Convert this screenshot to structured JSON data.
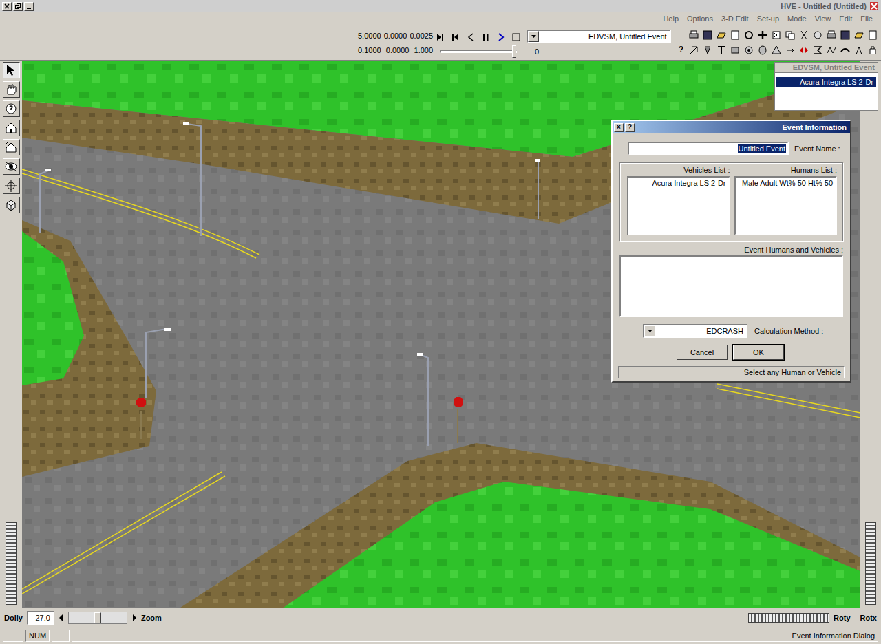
{
  "window": {
    "title": "HVE - Untitled (Untitled)"
  },
  "menu": [
    "File",
    "Edit",
    "View",
    "Mode",
    "Set-up",
    "3-D Edit",
    "Options",
    "Help"
  ],
  "toolbar": {
    "numbers_top": [
      "5.0000",
      "0.0000",
      "0.0025"
    ],
    "numbers_bottom": [
      "0.1000",
      "0.0000",
      "1.000"
    ],
    "time_value": "0",
    "time_level": 0,
    "event_combo": "EDVSM, Untitled Event",
    "help_glyph": "?"
  },
  "tree": {
    "header": "EDVSM, Untitled Event",
    "items": [
      {
        "label": "Acura Integra LS 2-Dr",
        "selected": true
      }
    ]
  },
  "dialog": {
    "title": "Event Information",
    "title_buttons": [
      "?",
      "×"
    ],
    "event_name_label": "Event Name :",
    "event_name_value": "Untitled Event",
    "humans_label": "Humans List :",
    "humans": [
      "Male Adult Wt% 50 Ht% 50"
    ],
    "vehicles_label": "Vehicles List :",
    "vehicles": [
      "Acura Integra LS 2-Dr"
    ],
    "event_list_label": "Event Humans and Vehicles :",
    "event_list": [],
    "calc_label": "Calculation Method :",
    "calc_value": "EDCRASH",
    "buttons": [
      "OK",
      "Cancel"
    ],
    "hint": "Select any Human or Vehicle"
  },
  "view_controls": {
    "dolly_label": "Dolly",
    "dolly_value": "27.0",
    "zoom_label": "Zoom",
    "zoom_level": 0.5,
    "roty_label": "Roty",
    "rotx_label": "Rotx"
  },
  "status_bar": {
    "message": "Event Information Dialog",
    "indicators": [
      "NUM"
    ]
  }
}
